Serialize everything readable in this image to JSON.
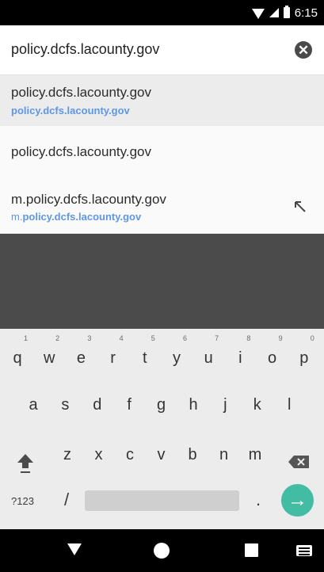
{
  "status_bar": {
    "time": "6:15",
    "icons": [
      "wifi-icon",
      "signal-icon",
      "battery-icon"
    ]
  },
  "address_bar": {
    "url": "policy.dcfs.lacounty.gov",
    "clear_icon": "close-icon"
  },
  "suggestions": [
    {
      "title": "policy.dcfs.lacounty.gov",
      "url": "policy.dcfs.lacounty.gov"
    },
    {
      "title": "policy.dcfs.lacounty.gov"
    },
    {
      "title": "m.policy.dcfs.lacounty.gov",
      "url_prefix": "m.",
      "url_bold": "policy.dcfs.lacounty.gov",
      "action_icon": "insert-arrow-icon"
    }
  ],
  "keyboard": {
    "row1": [
      {
        "key": "q",
        "hint": "1"
      },
      {
        "key": "w",
        "hint": "2"
      },
      {
        "key": "e",
        "hint": "3"
      },
      {
        "key": "r",
        "hint": "4"
      },
      {
        "key": "t",
        "hint": "5"
      },
      {
        "key": "y",
        "hint": "6"
      },
      {
        "key": "u",
        "hint": "7"
      },
      {
        "key": "i",
        "hint": "8"
      },
      {
        "key": "o",
        "hint": "9"
      },
      {
        "key": "p",
        "hint": "0"
      }
    ],
    "row2": [
      "a",
      "s",
      "d",
      "f",
      "g",
      "h",
      "j",
      "k",
      "l"
    ],
    "row3": [
      "z",
      "x",
      "c",
      "v",
      "b",
      "n",
      "m"
    ],
    "row4": {
      "symbols": "?123",
      "slash": "/",
      "period": ".",
      "go_icon": "arrow-right-icon"
    }
  },
  "nav_bar": {
    "icons": [
      "back-icon",
      "home-icon",
      "recents-icon",
      "keyboard-icon"
    ]
  }
}
